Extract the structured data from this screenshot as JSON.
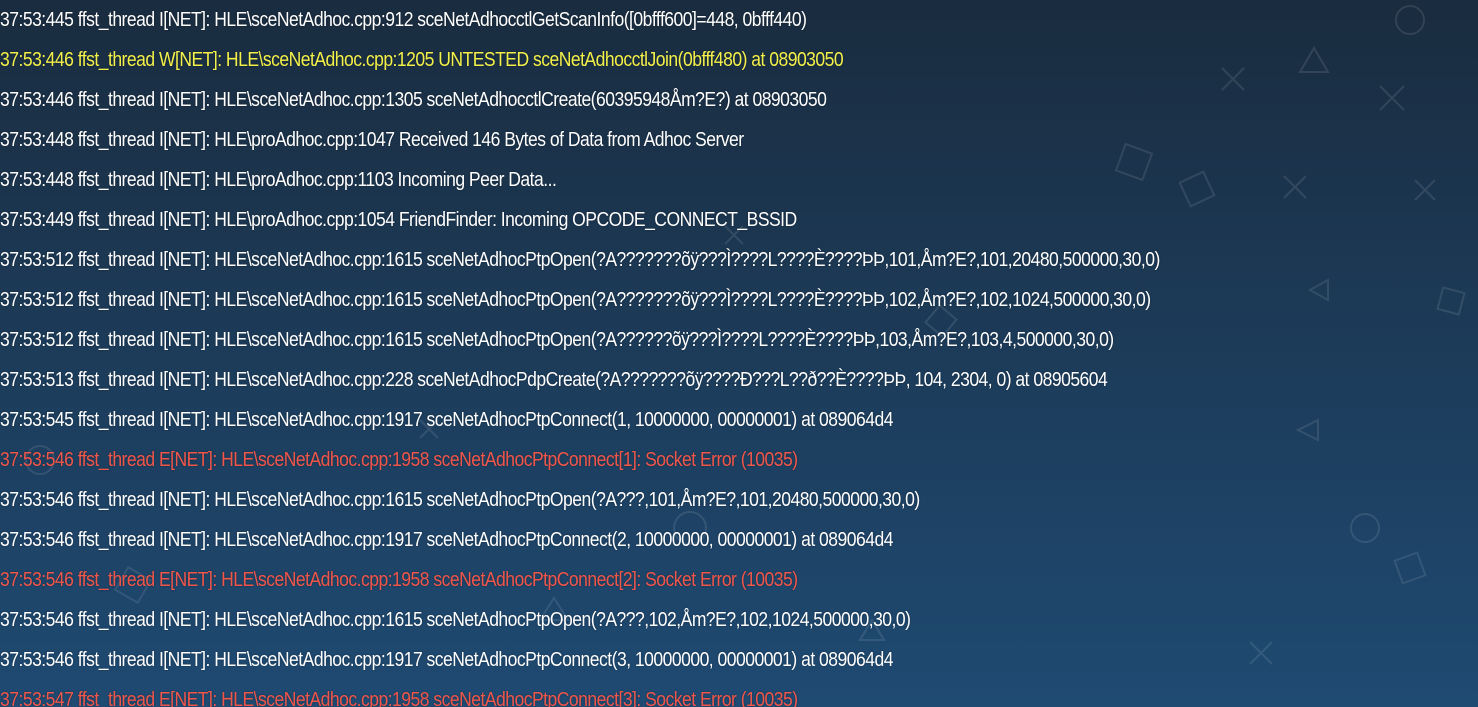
{
  "colors": {
    "info": "#ffffff",
    "warning": "#f3f04a",
    "error": "#f0564a",
    "background_top": "#1a2c3f",
    "background_bottom": "#1f4a72"
  },
  "log": {
    "lines": [
      {
        "level": "I",
        "text": "37:53:445 ffst_thread  I[NET]: HLE\\sceNetAdhoc.cpp:912 sceNetAdhocctlGetScanInfo([0bfff600]=448, 0bfff440)"
      },
      {
        "level": "W",
        "text": "37:53:446 ffst_thread  W[NET]: HLE\\sceNetAdhoc.cpp:1205 UNTESTED sceNetAdhocctlJoin(0bfff480) at 08903050"
      },
      {
        "level": "I",
        "text": "37:53:446 ffst_thread  I[NET]: HLE\\sceNetAdhoc.cpp:1305 sceNetAdhocctlCreate(60395948Åm?E?) at 08903050"
      },
      {
        "level": "I",
        "text": "37:53:448 ffst_thread  I[NET]: HLE\\proAdhoc.cpp:1047 Received 146 Bytes of Data from Adhoc Server"
      },
      {
        "level": "I",
        "text": "37:53:448 ffst_thread  I[NET]: HLE\\proAdhoc.cpp:1103 Incoming Peer Data..."
      },
      {
        "level": "I",
        "text": "37:53:449 ffst_thread  I[NET]: HLE\\proAdhoc.cpp:1054 FriendFinder: Incoming OPCODE_CONNECT_BSSID"
      },
      {
        "level": "I",
        "text": "37:53:512 ffst_thread  I[NET]: HLE\\sceNetAdhoc.cpp:1615 sceNetAdhocPtpOpen(?A???????õÿ???Ì????L????È????ÞÞ,101,Åm?E?,101,20480,500000,30,0)"
      },
      {
        "level": "I",
        "text": "37:53:512 ffst_thread  I[NET]: HLE\\sceNetAdhoc.cpp:1615 sceNetAdhocPtpOpen(?A???????õÿ???Ì????L????È????ÞÞ,102,Åm?E?,102,1024,500000,30,0)"
      },
      {
        "level": "I",
        "text": "37:53:512 ffst_thread  I[NET]: HLE\\sceNetAdhoc.cpp:1615 sceNetAdhocPtpOpen(?A??????õÿ???Ì????L????È????ÞÞ,103,Åm?E?,103,4,500000,30,0)"
      },
      {
        "level": "I",
        "text": "37:53:513 ffst_thread  I[NET]: HLE\\sceNetAdhoc.cpp:228 sceNetAdhocPdpCreate(?A???????õÿ????Ð???L??ð??È????ÞÞ, 104, 2304, 0) at 08905604"
      },
      {
        "level": "I",
        "text": "37:53:545 ffst_thread  I[NET]: HLE\\sceNetAdhoc.cpp:1917 sceNetAdhocPtpConnect(1, 10000000, 00000001) at 089064d4"
      },
      {
        "level": "E",
        "text": "37:53:546 ffst_thread  E[NET]: HLE\\sceNetAdhoc.cpp:1958 sceNetAdhocPtpConnect[1]: Socket Error (10035)"
      },
      {
        "level": "I",
        "text": "37:53:546 ffst_thread  I[NET]: HLE\\sceNetAdhoc.cpp:1615 sceNetAdhocPtpOpen(?A???,101,Åm?E?,101,20480,500000,30,0)"
      },
      {
        "level": "I",
        "text": "37:53:546 ffst_thread  I[NET]: HLE\\sceNetAdhoc.cpp:1917 sceNetAdhocPtpConnect(2, 10000000, 00000001) at 089064d4"
      },
      {
        "level": "E",
        "text": "37:53:546 ffst_thread  E[NET]: HLE\\sceNetAdhoc.cpp:1958 sceNetAdhocPtpConnect[2]: Socket Error (10035)"
      },
      {
        "level": "I",
        "text": "37:53:546 ffst_thread  I[NET]: HLE\\sceNetAdhoc.cpp:1615 sceNetAdhocPtpOpen(?A???,102,Åm?E?,102,1024,500000,30,0)"
      },
      {
        "level": "I",
        "text": "37:53:546 ffst_thread  I[NET]: HLE\\sceNetAdhoc.cpp:1917 sceNetAdhocPtpConnect(3, 10000000, 00000001) at 089064d4"
      },
      {
        "level": "E",
        "text": "37:53:547 ffst_thread  E[NET]: HLE\\sceNetAdhoc.cpp:1958 sceNetAdhocPtpConnect[3]: Socket Error (10035)"
      }
    ]
  }
}
